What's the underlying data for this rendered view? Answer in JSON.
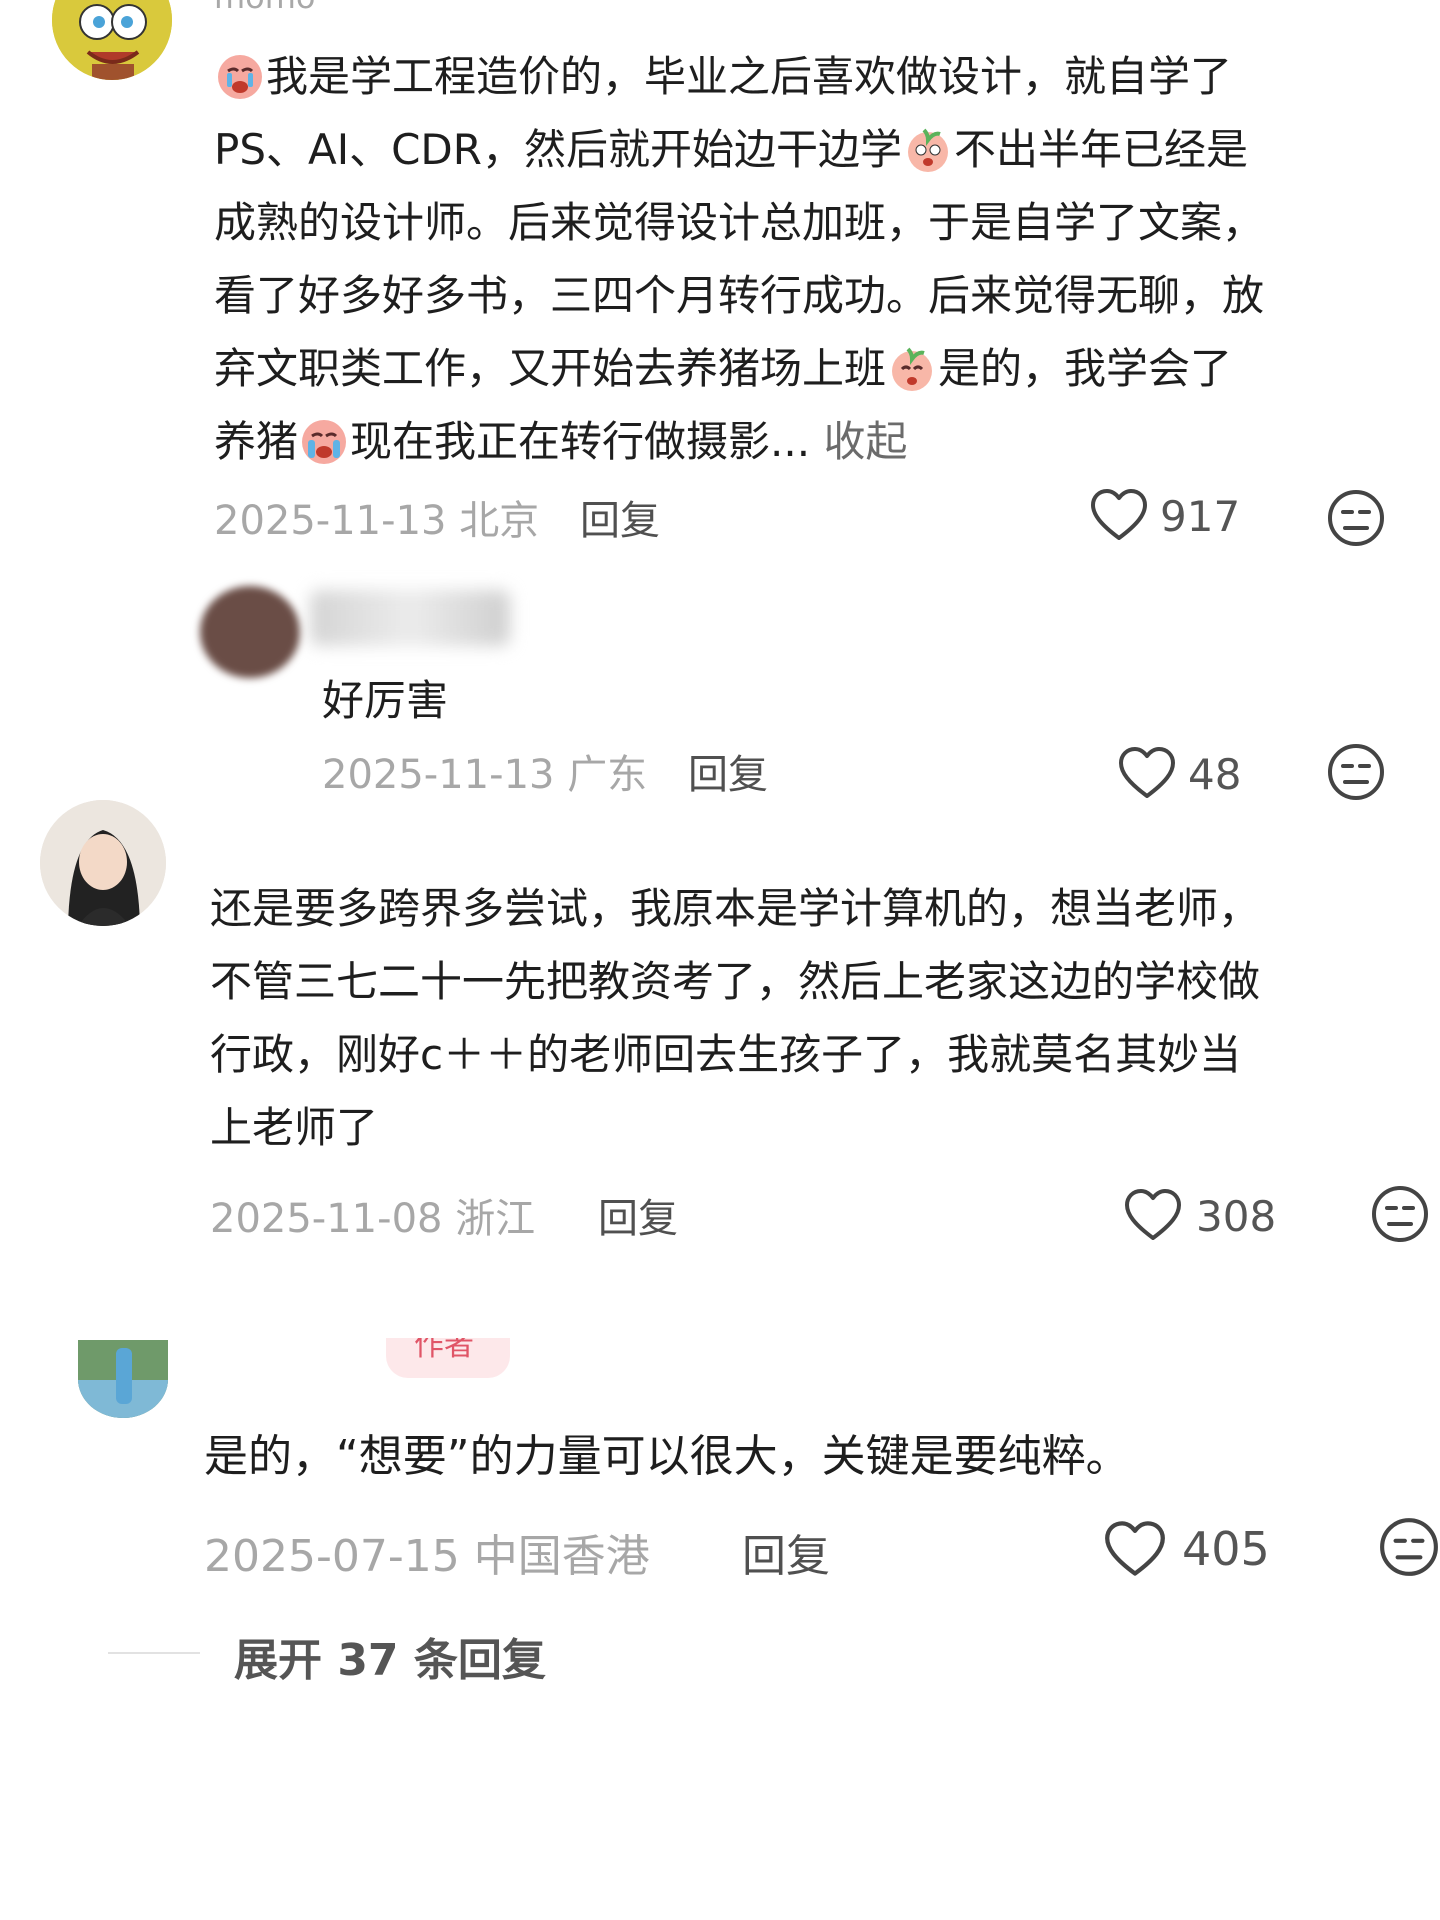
{
  "comments": [
    {
      "username": "momo",
      "text_parts": [
        "我是学工程造价的，毕业之后喜欢做设计，就自学了",
        "PS、AI、CDR，然后就开始边干边学",
        "不出半年已经是",
        "成熟的设计师。后来觉得设计总加班，于是自学了文案，",
        "看了好多好多书，三四个月转行成功。后来觉得无聊，放",
        "弃文职类工作，又开始去养猪场上班",
        "是的，我学会了",
        "养猪",
        "现在我正在转行做摄影...",
        "收起"
      ],
      "date": "2025-11-13",
      "location": "北京",
      "reply_label": "回复",
      "likes": "917"
    },
    {
      "text": "好厉害",
      "date": "2025-11-13",
      "location": "广东",
      "reply_label": "回复",
      "likes": "48"
    },
    {
      "lines": [
        "还是要多跨界多尝试，我原本是学计算机的，想当老师，",
        "不管三七二十一先把教资考了，然后上老家这边的学校做",
        "行政，刚好c＋＋的老师回去生孩子了，我就莫名其妙当",
        "上老师了"
      ],
      "date": "2025-11-08",
      "location": "浙江",
      "reply_label": "回复",
      "likes": "308"
    },
    {
      "badge": "作者",
      "text": "是的，“想要”的力量可以很大，关键是要纯粹。",
      "date": "2025-07-15",
      "location": "中国香港",
      "reply_label": "回复",
      "likes": "405"
    }
  ],
  "expand_replies": "展开 37 条回复",
  "colors": {
    "text": "#1e1e1e",
    "meta": "#a7a7a7",
    "badge_bg": "#fde8ea",
    "badge_text": "#e05567"
  },
  "icons": [
    "heart-outline-icon",
    "meh-face-icon",
    "crying-emoji-icon",
    "peach-emoji-icon"
  ]
}
